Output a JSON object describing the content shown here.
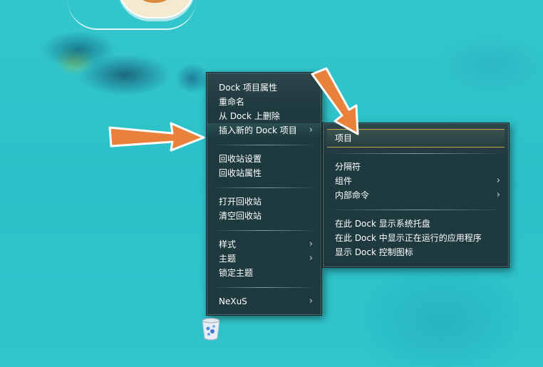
{
  "main_menu": {
    "items": [
      {
        "label": "Dock 项目属性"
      },
      {
        "label": "重命名"
      },
      {
        "label": "从 Dock 上删除"
      },
      {
        "label": "插入新的 Dock 项目"
      },
      {
        "label": "回收站设置"
      },
      {
        "label": "回收站属性"
      },
      {
        "label": "打开回收站"
      },
      {
        "label": "清空回收站"
      },
      {
        "label": "样式"
      },
      {
        "label": "主题"
      },
      {
        "label": "锁定主题"
      },
      {
        "label": "NeXuS"
      }
    ]
  },
  "sub_menu": {
    "items": [
      {
        "label": "项目"
      },
      {
        "label": "分隔符"
      },
      {
        "label": "组件"
      },
      {
        "label": "内部命令"
      },
      {
        "label": "在此 Dock 显示系统托盘"
      },
      {
        "label": "在此 Dock 中显示正在运行的应用程序"
      },
      {
        "label": "显示 Dock 控制图标"
      }
    ]
  },
  "icons": {
    "submenu_arrow": "chevron-right-icon",
    "dock_item": "recycle-bin-icon",
    "annotations": "orange-arrow-icon"
  },
  "colors": {
    "menu_bg": "#1f3a3f",
    "highlight_border": "#c9a64a",
    "arrow": "#e8823a",
    "desktop": "#2ec3c9"
  }
}
